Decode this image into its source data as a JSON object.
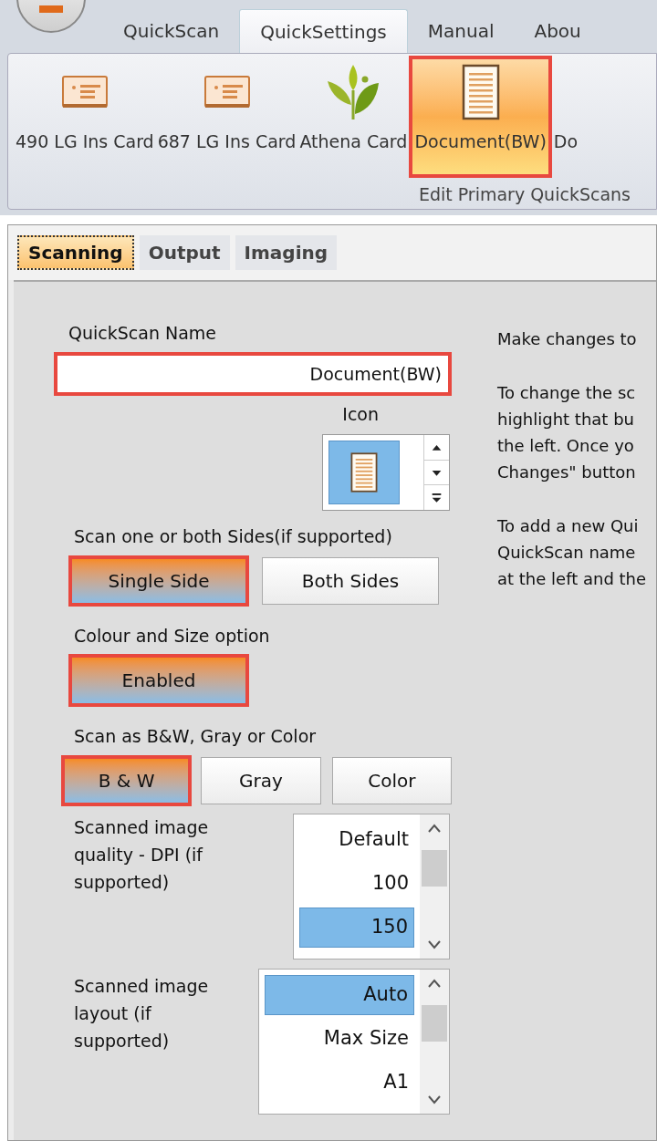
{
  "ribbon_tabs": [
    {
      "label": "QuickScan",
      "selected": false
    },
    {
      "label": "QuickSettings",
      "selected": true
    },
    {
      "label": "Manual",
      "selected": false
    },
    {
      "label": "Abou",
      "selected": false
    }
  ],
  "ribbon_items": [
    {
      "label": "490 LG Ins Card",
      "kind": "card",
      "selected": false
    },
    {
      "label": "687 LG Ins Card",
      "kind": "card",
      "selected": false
    },
    {
      "label": "Athena Card",
      "kind": "plant",
      "selected": false
    },
    {
      "label": "Document(BW)",
      "kind": "document",
      "selected": true
    },
    {
      "label": "Do",
      "kind": "hidden",
      "selected": false
    }
  ],
  "ribbon_group_label": "Edit Primary QuickScans",
  "settings_tabs": [
    {
      "label": "Scanning",
      "selected": true
    },
    {
      "label": "Output",
      "selected": false
    },
    {
      "label": "Imaging",
      "selected": false
    }
  ],
  "quickscan_name": {
    "label": "QuickScan Name",
    "value": "Document(BW)",
    "highlighted": true
  },
  "icon_picker": {
    "label": "Icon"
  },
  "sides": {
    "label": "Scan one or both Sides(if supported)",
    "options": [
      {
        "label": "Single Side",
        "selected": true
      },
      {
        "label": "Both Sides",
        "selected": false
      }
    ]
  },
  "colour_size": {
    "label": "Colour and Size option",
    "button": "Enabled",
    "on": true
  },
  "color_mode": {
    "label": "Scan as B&W, Gray or Color",
    "options": [
      {
        "label": "B & W",
        "selected": true
      },
      {
        "label": "Gray",
        "selected": false
      },
      {
        "label": "Color",
        "selected": false
      }
    ]
  },
  "dpi": {
    "label": "Scanned image quality - DPI (if supported)",
    "items": [
      {
        "label": "Default",
        "selected": false
      },
      {
        "label": "100",
        "selected": false
      },
      {
        "label": "150",
        "selected": true
      }
    ]
  },
  "layout": {
    "label": "Scanned image layout (if supported)",
    "items": [
      {
        "label": "Auto",
        "selected": true
      },
      {
        "label": "Max Size",
        "selected": false
      },
      {
        "label": "A1",
        "selected": false
      }
    ]
  },
  "help": [
    [
      "Make changes to"
    ],
    [
      "To change the sc",
      "highlight that bu",
      "the left.  Once yo",
      "Changes\" button"
    ],
    [
      "To add a new Qui",
      "QuickScan name",
      "at the left and the"
    ]
  ]
}
